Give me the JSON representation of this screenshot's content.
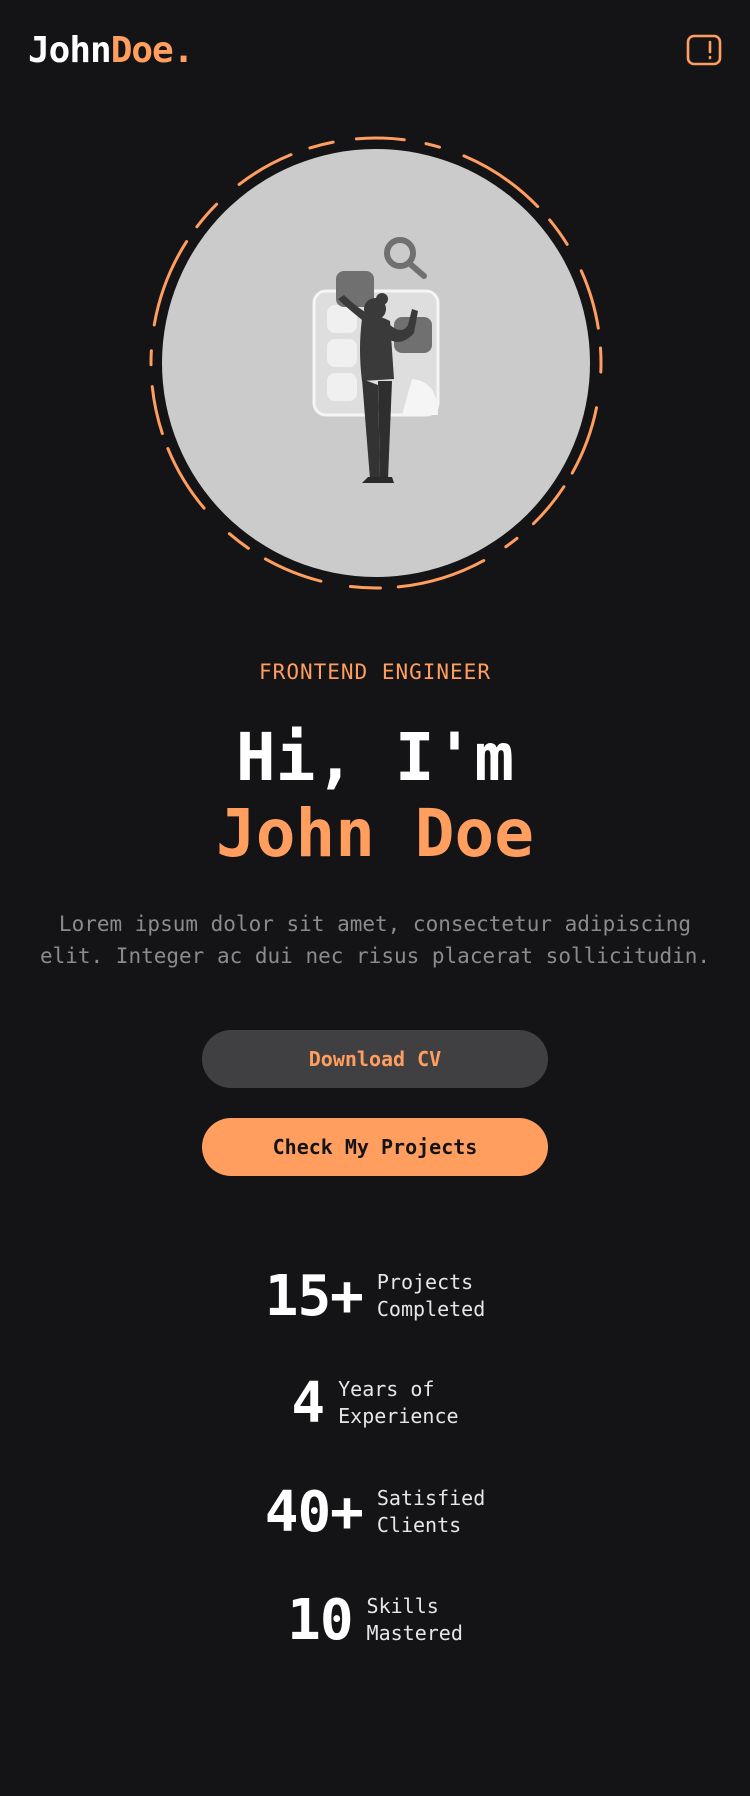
{
  "header": {
    "logo_first": "John",
    "logo_last": "Doe",
    "logo_dot": ".",
    "menu_icon": "menu-toggle-icon"
  },
  "hero": {
    "illustration": "person-at-dashboard-illustration",
    "role": "FRONTEND ENGINEER",
    "greeting": "Hi, I'm",
    "name": "John Doe",
    "description": "Lorem ipsum dolor sit amet, consectetur adipiscing elit. Integer ac dui nec risus placerat sollicitudin."
  },
  "buttons": {
    "download_cv": "Download CV",
    "check_projects": "Check My Projects"
  },
  "stats": [
    {
      "value": "15+",
      "label": "Projects\nCompleted"
    },
    {
      "value": "4",
      "label": "Years of\nExperience"
    },
    {
      "value": "40+",
      "label": "Satisfied\nClients"
    },
    {
      "value": "10",
      "label": "Skills\nMastered"
    }
  ],
  "colors": {
    "background": "#141416",
    "accent": "#ff9e5e",
    "button_secondary": "#404043",
    "muted_text": "#8b8b8f",
    "hero_circle": "#cbcbcb"
  }
}
